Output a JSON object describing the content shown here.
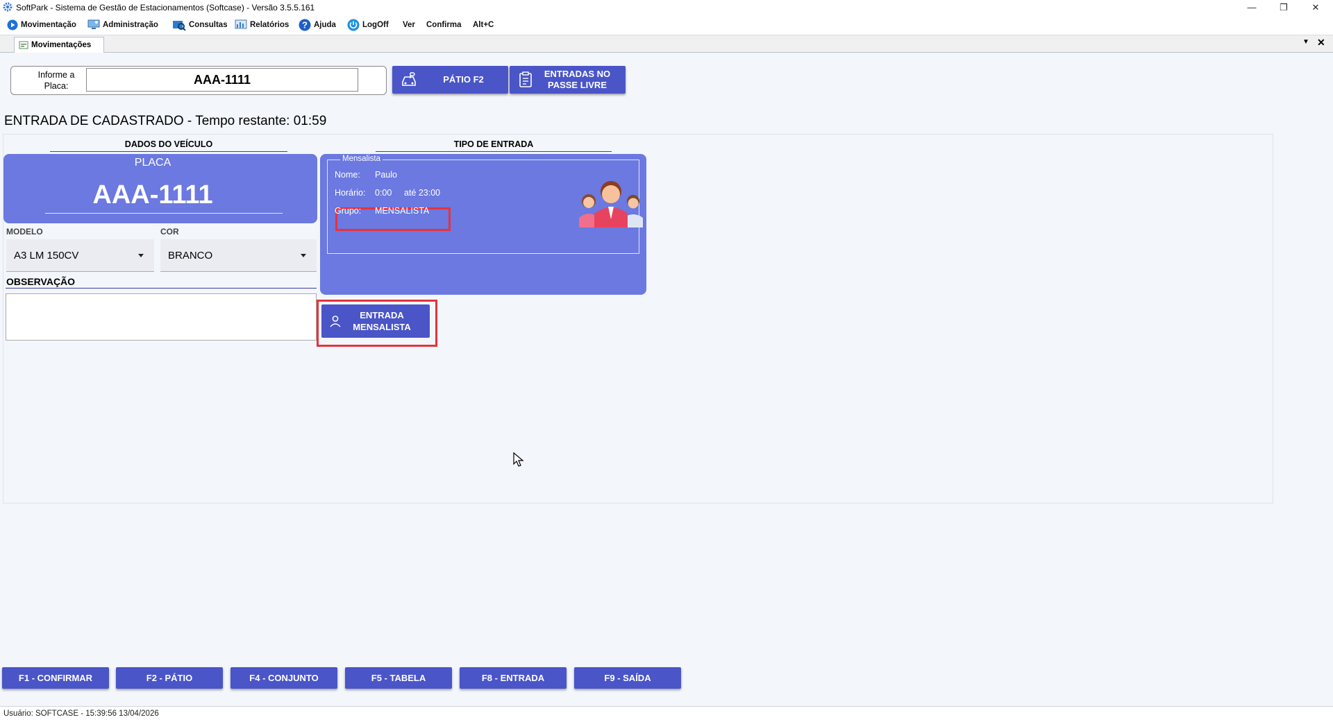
{
  "window": {
    "title": "SoftPark - Sistema de Gestão de Estacionamentos (Softcase) - Versão 3.5.5.161",
    "controls": {
      "minimize": "—",
      "restore": "❐",
      "close": "✕"
    }
  },
  "menu": {
    "items": [
      {
        "label": "Movimentação",
        "icon": "play-icon"
      },
      {
        "label": "Administração",
        "icon": "monitor-icon"
      },
      {
        "label": "Consultas",
        "icon": "search-icon"
      },
      {
        "label": "Relatórios",
        "icon": "report-icon"
      },
      {
        "label": "Ajuda",
        "icon": "help-icon"
      },
      {
        "label": "LogOff",
        "icon": "power-icon"
      },
      {
        "label": "Ver"
      },
      {
        "label": "Confirma"
      },
      {
        "label": "Alt+C"
      }
    ]
  },
  "tab": {
    "label": "Movimentações",
    "dropdown": "▼",
    "close": "✕"
  },
  "plate_entry": {
    "label": "Informe a Placa:",
    "value": "AAA-1111"
  },
  "top_buttons": {
    "patio": "PÁTIO F2",
    "passe_livre": "ENTRADAS NO PASSE LIVRE"
  },
  "header": "ENTRADA DE CADASTRADO - Tempo restante: 01:59",
  "vehicle": {
    "section_title": "DADOS DO VEÍCULO",
    "plate_caption": "PLACA",
    "plate": "AAA-1111",
    "model_caption": "MODELO",
    "model": "A3 LM 150CV",
    "color_caption": "COR",
    "color": "BRANCO",
    "obs_caption": "OBSERVAÇÃO",
    "obs": ""
  },
  "entry_type": {
    "section_title": "TIPO DE ENTRADA",
    "group_legend": "Mensalista",
    "name_label": "Nome:",
    "name": "Paulo",
    "schedule_label": "Horário:",
    "schedule_from": "0:00",
    "schedule_to": "até 23:00",
    "group_label": "Grupo:",
    "group": "MENSALISTA",
    "entry_button": "ENTRADA MENSALISTA"
  },
  "function_keys": [
    "F1 - CONFIRMAR",
    "F2 - PÁTIO",
    "F4 - CONJUNTO",
    "F5 - TABELA",
    "F8 - ENTRADA",
    "F9 - SAÍDA"
  ],
  "status": "Usuário:  SOFTCASE - 15:39:56 13/04/2026",
  "colors": {
    "accent": "#4a55c8",
    "card": "#6b79e0",
    "highlight": "#e8323c"
  }
}
